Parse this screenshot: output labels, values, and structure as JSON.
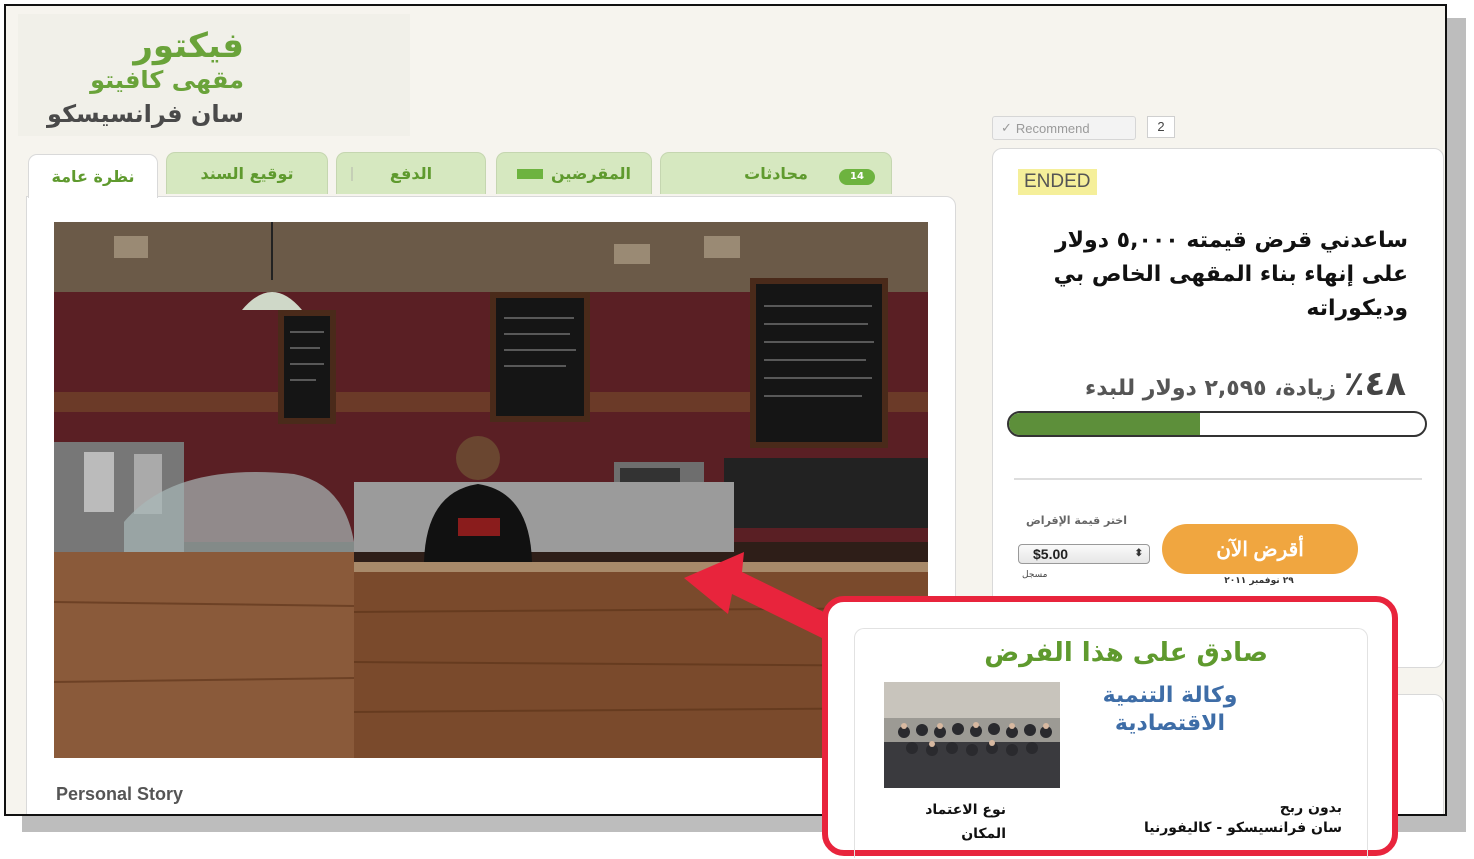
{
  "brand": {
    "line1": "فيكتور",
    "line2": "مقهى كافيتو",
    "line3": "سان فرانسيسكو"
  },
  "tabs": [
    {
      "id": "overview",
      "label": "نظرة عامة",
      "active": true
    },
    {
      "id": "note",
      "label": "توقيع السند"
    },
    {
      "id": "payment",
      "label": "الدفع"
    },
    {
      "id": "lenders",
      "label": "المقرضين"
    },
    {
      "id": "conversations",
      "label": "محادثات",
      "badge": "14"
    }
  ],
  "main": {
    "story_heading": "Personal Story"
  },
  "social": {
    "recommend_label": "Recommend",
    "recommend_count": "2",
    "icon": "check-icon"
  },
  "loan": {
    "status": "ENDED",
    "title": "ساعدني قرض قيمته ٥,٠٠٠ دولار على إنهاء بناء المقهى الخاص بي وديكوراته",
    "raised_pct": "٤٨٪",
    "raised_text": "زيادة، ٢,٥٩٥ دولار للبدء",
    "progress": 0.46,
    "amount_label": "اختر قيمة الإقراض",
    "amount_value": "$5.00",
    "registered_label": "مسجل",
    "lend_button": "أقرض الآن",
    "date": "٢٩ نوفمبر ٢٠١١"
  },
  "endorser": {
    "heading": "صادق على هذا الفرض",
    "org_name": "وكالة التنمية الاقتصادية",
    "nonprofit": "بدون ربح",
    "location": "سان فرانسيسكو - كاليفورنيا",
    "type_label": "نوع الاعتماد",
    "place_label": "المكان"
  },
  "colors": {
    "brand_green": "#6aa33a",
    "accent_orange": "#f0a640",
    "highlight_red": "#e8243c",
    "progress_green": "#5d8f3a",
    "org_blue": "#3e6da7"
  }
}
